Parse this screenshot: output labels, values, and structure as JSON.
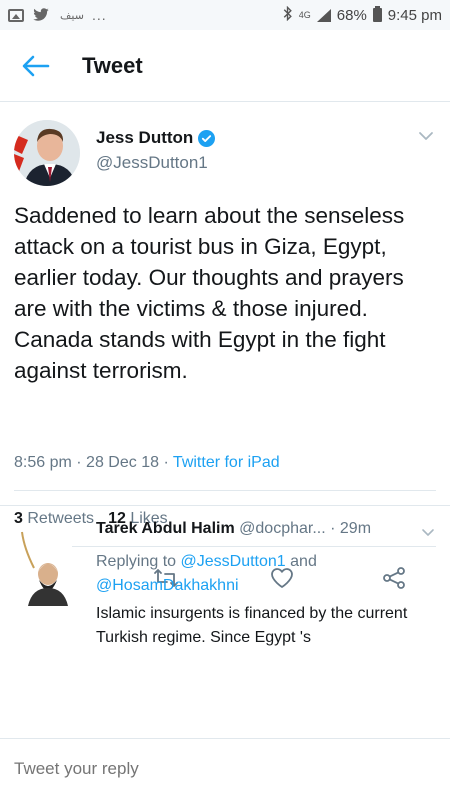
{
  "status_bar": {
    "left_text": "...",
    "arabic_snippet": "سيف",
    "network": "4G",
    "battery": "68%",
    "time": "9:45 pm"
  },
  "header": {
    "title": "Tweet"
  },
  "tweet": {
    "author_name": "Jess Dutton",
    "author_handle": "@JessDutton1",
    "text": "Saddened to learn about the senseless attack on a tourist bus in Giza, Egypt, earlier today. Our thoughts and prayers are with the victims & those injured. Canada stands with Egypt in the fight against terrorism.",
    "time": "8:56 pm",
    "date": "28 Dec 18",
    "source": "Twitter for iPad",
    "retweets_count": "3",
    "retweets_label": "Retweets",
    "likes_count": "12",
    "likes_label": "Likes"
  },
  "reply": {
    "name": "Tarek Abdul Halim",
    "handle": "@docphar...",
    "time": "· 29m",
    "replying_prefix": "Replying to",
    "mention_1": "@JessDutton1",
    "and": "and",
    "mention_2": "@HosamDakhakhni",
    "text": "Islamic insurgents is financed by the current Turkish regime. Since Egypt 's"
  },
  "compose": {
    "placeholder": "Tweet your reply"
  },
  "colors": {
    "accent": "#1da1f2",
    "text": "#14171a",
    "secondary": "#657786",
    "divider": "#e1e8ed"
  }
}
